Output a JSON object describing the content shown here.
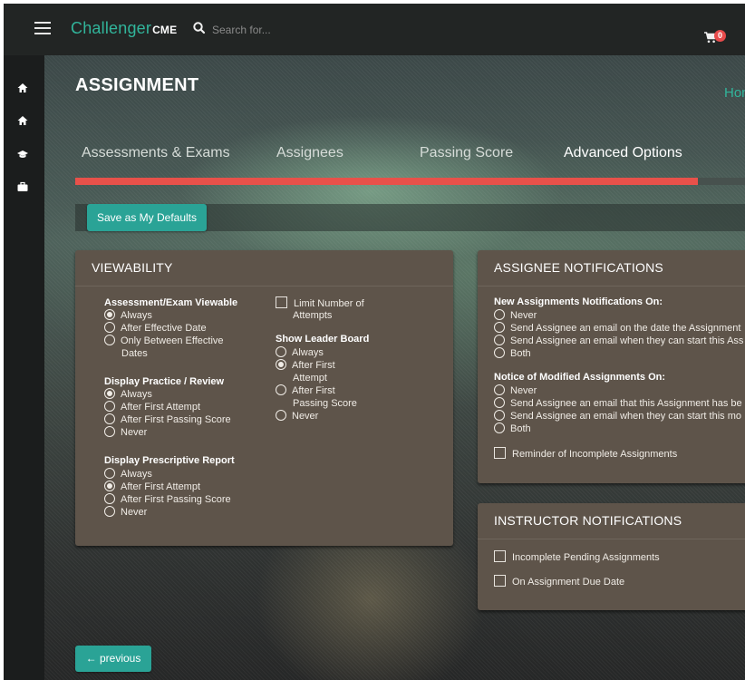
{
  "header": {
    "brand_main": "Challenger",
    "brand_suffix": "CME",
    "search_placeholder": "Search for...",
    "cart_count": "0"
  },
  "page": {
    "title": "ASSIGNMENT",
    "home_link": "Hom"
  },
  "tabs": [
    {
      "label": "Assessments & Exams",
      "active": false
    },
    {
      "label": "Assignees",
      "active": false
    },
    {
      "label": "Passing Score",
      "active": false
    },
    {
      "label": "Advanced Options",
      "active": true
    }
  ],
  "progress": {
    "fraction": 0.93
  },
  "buttons": {
    "save_defaults": "Save as My Defaults",
    "previous": "← previous"
  },
  "viewability": {
    "title": "VIEWABILITY",
    "exam_viewable": {
      "label": "Assessment/Exam Viewable",
      "options": [
        "Always",
        "After Effective Date",
        "Only Between Effective",
        "Dates"
      ]
    },
    "practice_review": {
      "label": "Display Practice / Review",
      "options": [
        "Always",
        "After First Attempt",
        "After First Passing Score",
        "Never"
      ]
    },
    "prescriptive_report": {
      "label": "Display Prescriptive Report",
      "options": [
        "Always",
        "After First Attempt",
        "After First Passing Score",
        "Never"
      ]
    },
    "limit_attempts": [
      "Limit Number of",
      "Attempts"
    ],
    "leader_board": {
      "label": "Show Leader Board",
      "options": [
        "Always",
        "After First",
        "Attempt",
        "After First",
        "Passing Score",
        "Never"
      ]
    }
  },
  "assignee_notifications": {
    "title": "ASSIGNEE NOTIFICATIONS",
    "new_label": "New Assignments Notifications On:",
    "new_options": [
      "Never",
      "Send Assignee an email on the date the Assignment",
      "Send Assignee an email when they can start this Ass",
      "Both"
    ],
    "modified_label": "Notice of Modified Assignments On:",
    "modified_options": [
      "Never",
      "Send Assignee an email that this Assignment has be",
      "Send Assignee an email when they can start this mo",
      "Both"
    ],
    "reminder": "Reminder of Incomplete Assignments"
  },
  "instructor_notifications": {
    "title": "INSTRUCTOR NOTIFICATIONS",
    "options": [
      "Incomplete Pending Assignments",
      "On Assignment Due Date"
    ]
  },
  "colors": {
    "accent": "#31b59b",
    "button": "#2aa396",
    "progress": "#e8514a",
    "panel": "#5e544a"
  }
}
